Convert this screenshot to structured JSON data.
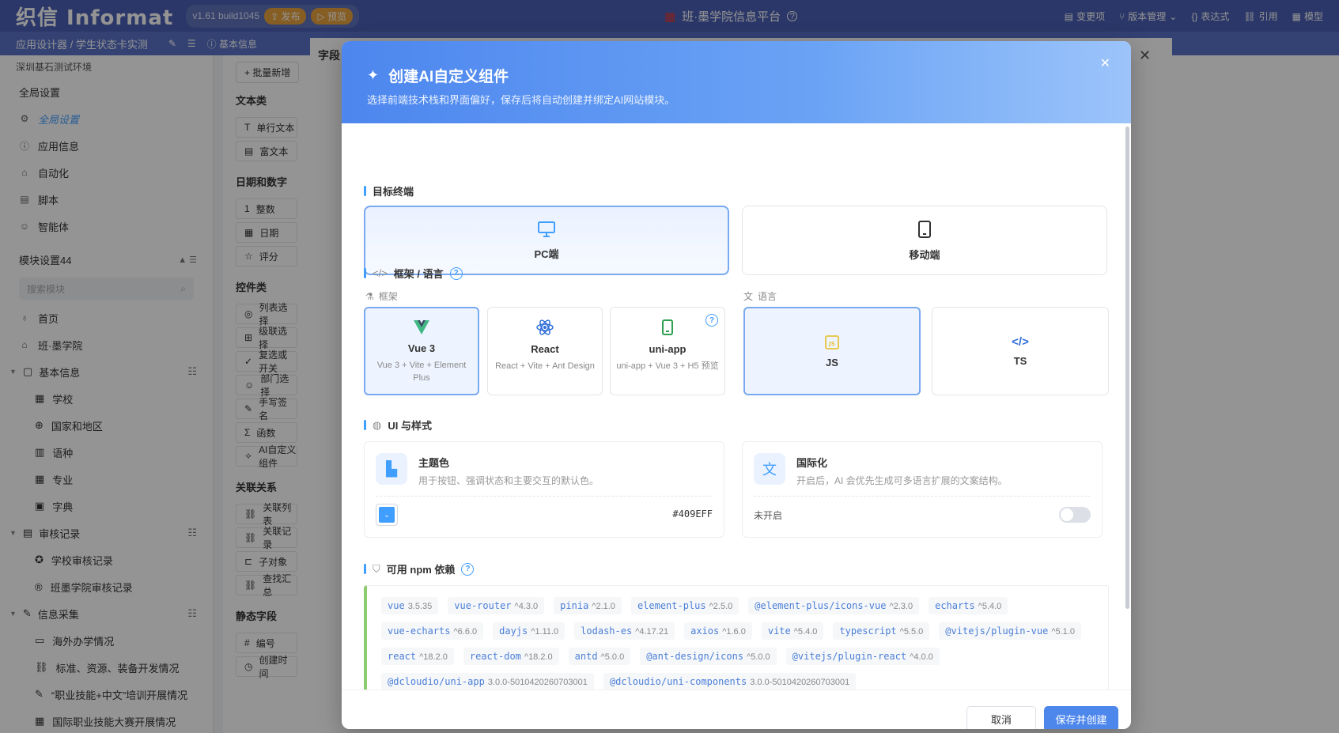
{
  "topbar": {
    "logo": "织信 Informat",
    "version": "v1.61 build1045",
    "publish": "发布",
    "preview": "预览",
    "platform_title": "班·墨学院信息平台",
    "right_items": [
      "变更项",
      "版本管理",
      "表达式",
      "引用",
      "模型"
    ]
  },
  "subbar": {
    "breadcrumb": "应用设计器 / 学生状态卡实测",
    "tab": "基本信息"
  },
  "sidebar": {
    "env": "深圳基石测试环境",
    "global_header": "全局设置",
    "global_items": [
      "全局设置",
      "应用信息",
      "自动化",
      "脚本",
      "智能体"
    ],
    "module_header": "模块设置44",
    "search_placeholder": "搜索模块",
    "top_items": [
      "首页",
      "班·墨学院"
    ],
    "groups": [
      {
        "name": "基本信息",
        "items": [
          "学校",
          "国家和地区",
          "语种",
          "专业",
          "字典"
        ]
      },
      {
        "name": "审核记录",
        "items": [
          "学校审核记录",
          "班墨学院审核记录"
        ]
      },
      {
        "name": "信息采集",
        "items": [
          "海外办学情况",
          "标准、资源、装备开发情况",
          "“职业技能+中文”培训开展情况",
          "国际职业技能大赛开展情况"
        ]
      }
    ]
  },
  "midcol": {
    "batch_add": "+ 批量新增",
    "sections": [
      {
        "title": "文本类",
        "items": [
          "单行文本",
          "富文本"
        ]
      },
      {
        "title": "日期和数字",
        "items": [
          "整数",
          "日期",
          "评分"
        ]
      },
      {
        "title": "控件类",
        "items": [
          "列表选择",
          "级联选择",
          "复选或开关",
          "部门选择",
          "手写签名",
          "函数",
          "AI自定义组件"
        ]
      },
      {
        "title": "关联关系",
        "items": [
          "关联列表",
          "关联记录",
          "子对象",
          "查找汇总"
        ]
      },
      {
        "title": "静态字段",
        "items": [
          "编号",
          "创建时间"
        ]
      }
    ]
  },
  "drawer": {
    "title": "字段"
  },
  "modal": {
    "title": "创建AI自定义组件",
    "subtitle": "选择前端技术栈和界面偏好，保存后将自动创建并绑定AI网站模块。",
    "terminal_title": "目标终端",
    "terminals": [
      "PC端",
      "移动端"
    ],
    "framework_title": "框架 / 语言",
    "framework_label": "框架",
    "language_label": "语言",
    "frameworks": [
      {
        "name": "Vue 3",
        "desc": "Vue 3 + Vite + Element Plus"
      },
      {
        "name": "React",
        "desc": "React + Vite + Ant Design"
      },
      {
        "name": "uni-app",
        "desc": "uni-app + Vue 3 + H5 预览"
      }
    ],
    "languages": [
      "JS",
      "TS"
    ],
    "ui_title": "UI 与样式",
    "theme": {
      "title": "主题色",
      "desc": "用于按钮、强调状态和主要交互的默认色。",
      "value": "#409EFF"
    },
    "i18n": {
      "title": "国际化",
      "desc": "开启后，AI 会优先生成可多语言扩展的文案结构。",
      "state": "未开启"
    },
    "npm_title": "可用 npm 依赖",
    "deps": [
      {
        "name": "vue",
        "ver": "3.5.35"
      },
      {
        "name": "vue-router",
        "ver": "^4.3.0"
      },
      {
        "name": "pinia",
        "ver": "^2.1.0"
      },
      {
        "name": "element-plus",
        "ver": "^2.5.0"
      },
      {
        "name": "@element-plus/icons-vue",
        "ver": "^2.3.0"
      },
      {
        "name": "echarts",
        "ver": "^5.4.0"
      },
      {
        "name": "vue-echarts",
        "ver": "^6.6.0"
      },
      {
        "name": "dayjs",
        "ver": "^1.11.0"
      },
      {
        "name": "lodash-es",
        "ver": "^4.17.21"
      },
      {
        "name": "axios",
        "ver": "^1.6.0"
      },
      {
        "name": "vite",
        "ver": "^5.4.0"
      },
      {
        "name": "typescript",
        "ver": "^5.5.0"
      },
      {
        "name": "@vitejs/plugin-vue",
        "ver": "^5.1.0"
      },
      {
        "name": "react",
        "ver": "^18.2.0"
      },
      {
        "name": "react-dom",
        "ver": "^18.2.0"
      },
      {
        "name": "antd",
        "ver": "^5.0.0"
      },
      {
        "name": "@ant-design/icons",
        "ver": "^5.0.0"
      },
      {
        "name": "@vitejs/plugin-react",
        "ver": "^4.0.0"
      },
      {
        "name": "@dcloudio/uni-app",
        "ver": "3.0.0-5010420260703001"
      },
      {
        "name": "@dcloudio/uni-components",
        "ver": "3.0.0-5010420260703001"
      }
    ],
    "cancel": "取消",
    "save": "保存并创建"
  },
  "colors": {
    "accent": "#409EFF",
    "topbar": "#4a5fb3"
  }
}
